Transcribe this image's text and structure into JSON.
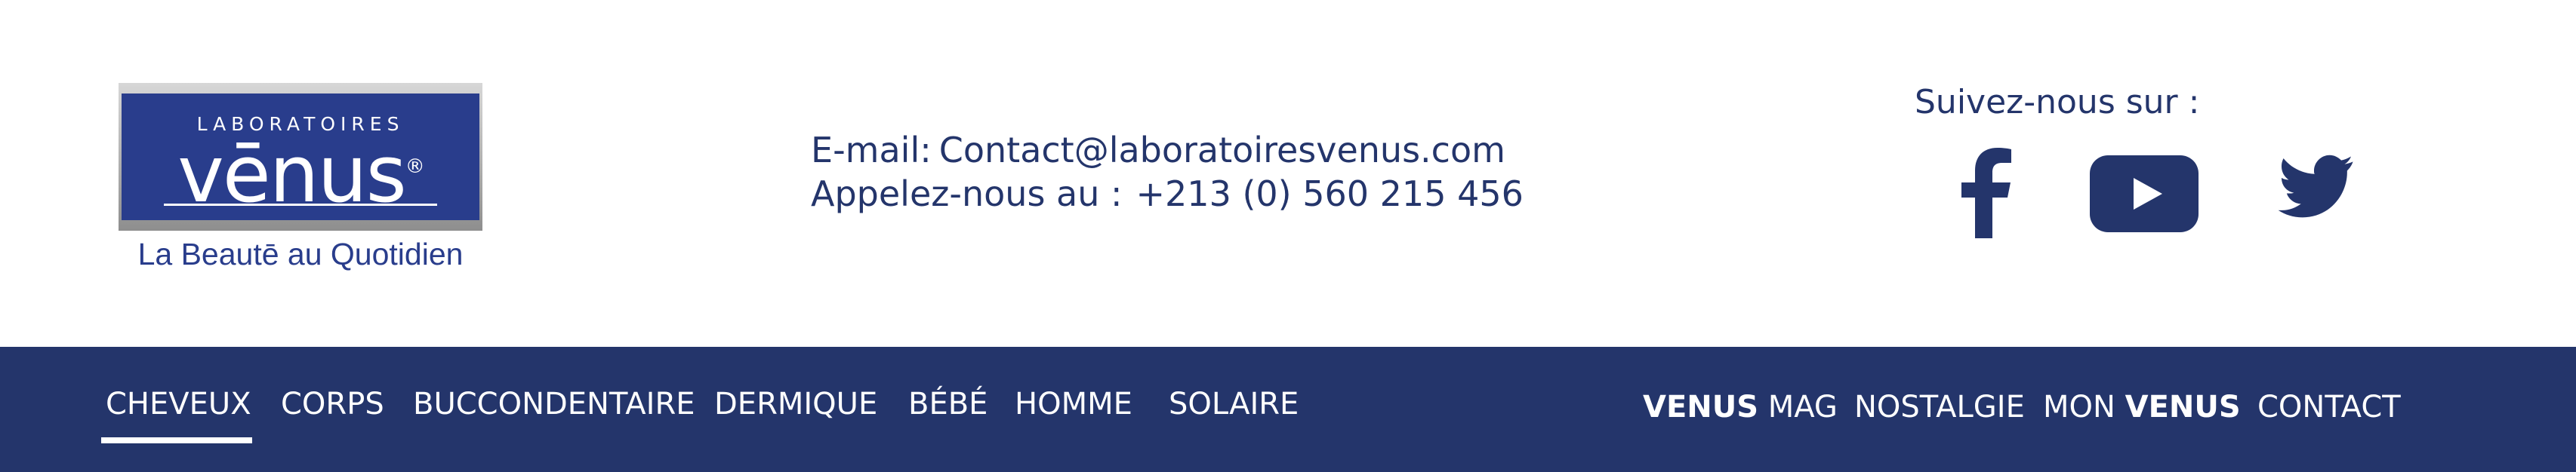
{
  "logo": {
    "top_text": "LABORATOIRES",
    "brand": "vēnus",
    "registered": "®",
    "tagline": "La Beautē au Quotidien"
  },
  "contact": {
    "email_label": "E-mail:",
    "email_value": "Contact@laboratoiresvenus.com",
    "phone_label": "Appelez-nous au :",
    "phone_value": "+213 (0) 560 215 456"
  },
  "social": {
    "label": "Suivez-nous sur :",
    "icons": [
      "facebook-icon",
      "youtube-icon",
      "twitter-icon"
    ]
  },
  "nav": {
    "left": [
      "CHEVEUX",
      "CORPS",
      "BUCCONDENTAIRE",
      "DERMIQUE",
      "BÉBÉ",
      "HOMME",
      "SOLAIRE"
    ],
    "active": "CHEVEUX",
    "right": {
      "venus_mag_bold": "VENUS",
      "venus_mag_rest": " MAG",
      "nostalgie": "NOSTALGIE",
      "mon_venus_rest": "MON ",
      "mon_venus_bold": "VENUS",
      "contact": "CONTACT"
    }
  },
  "colors": {
    "brand_navy": "#24356b",
    "logo_blue": "#293d8c",
    "white": "#ffffff"
  }
}
